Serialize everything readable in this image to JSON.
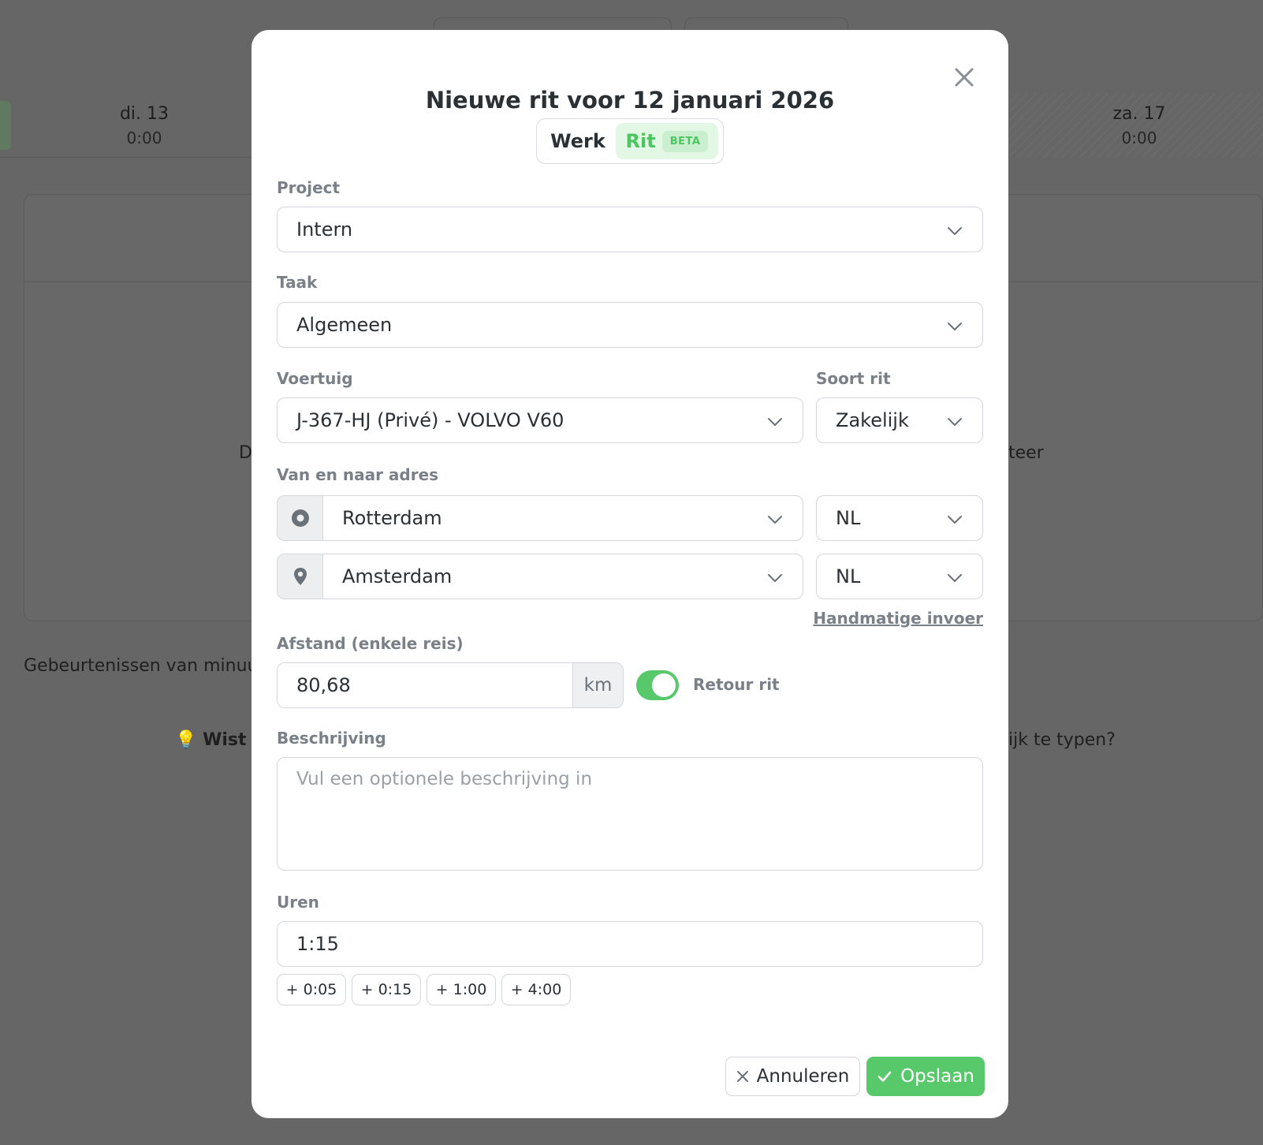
{
  "background": {
    "days": [
      {
        "label": "di. 13",
        "time": "0:00"
      },
      {
        "label": "za. 17",
        "time": "0:00"
      }
    ],
    "fragment_left": "D",
    "fragment_right": "teer",
    "events_text": "Gebeurtenissen van minuut",
    "tip_left": "Wist je",
    "tip_right": "ijk te typen?"
  },
  "modal": {
    "title": "Nieuwe rit voor 12 januari 2026",
    "tabs": {
      "werk": "Werk",
      "rit": "Rit",
      "badge": "BETA"
    },
    "project": {
      "label": "Project",
      "value": "Intern"
    },
    "taak": {
      "label": "Taak",
      "value": "Algemeen"
    },
    "voertuig": {
      "label": "Voertuig",
      "value": "J-367-HJ (Privé) - VOLVO V60"
    },
    "soort_rit": {
      "label": "Soort rit",
      "value": "Zakelijk"
    },
    "adres": {
      "label": "Van en naar adres",
      "from": {
        "value": "Rotterdam",
        "country": "NL"
      },
      "to": {
        "value": "Amsterdam",
        "country": "NL"
      },
      "manual_link": "Handmatige invoer"
    },
    "afstand": {
      "label": "Afstand (enkele reis)",
      "value": "80,68",
      "unit": "km"
    },
    "retour": {
      "label": "Retour rit",
      "checked": true
    },
    "beschrijving": {
      "label": "Beschrijving",
      "placeholder": "Vul een optionele beschrijving in"
    },
    "uren": {
      "label": "Uren",
      "value": "1:15",
      "quick": [
        "+ 0:05",
        "+ 0:15",
        "+ 1:00",
        "+ 4:00"
      ]
    },
    "buttons": {
      "cancel": "Annuleren",
      "save": "Opslaan"
    }
  },
  "colors": {
    "accent": "#58c96a",
    "overlay": "#666666"
  }
}
